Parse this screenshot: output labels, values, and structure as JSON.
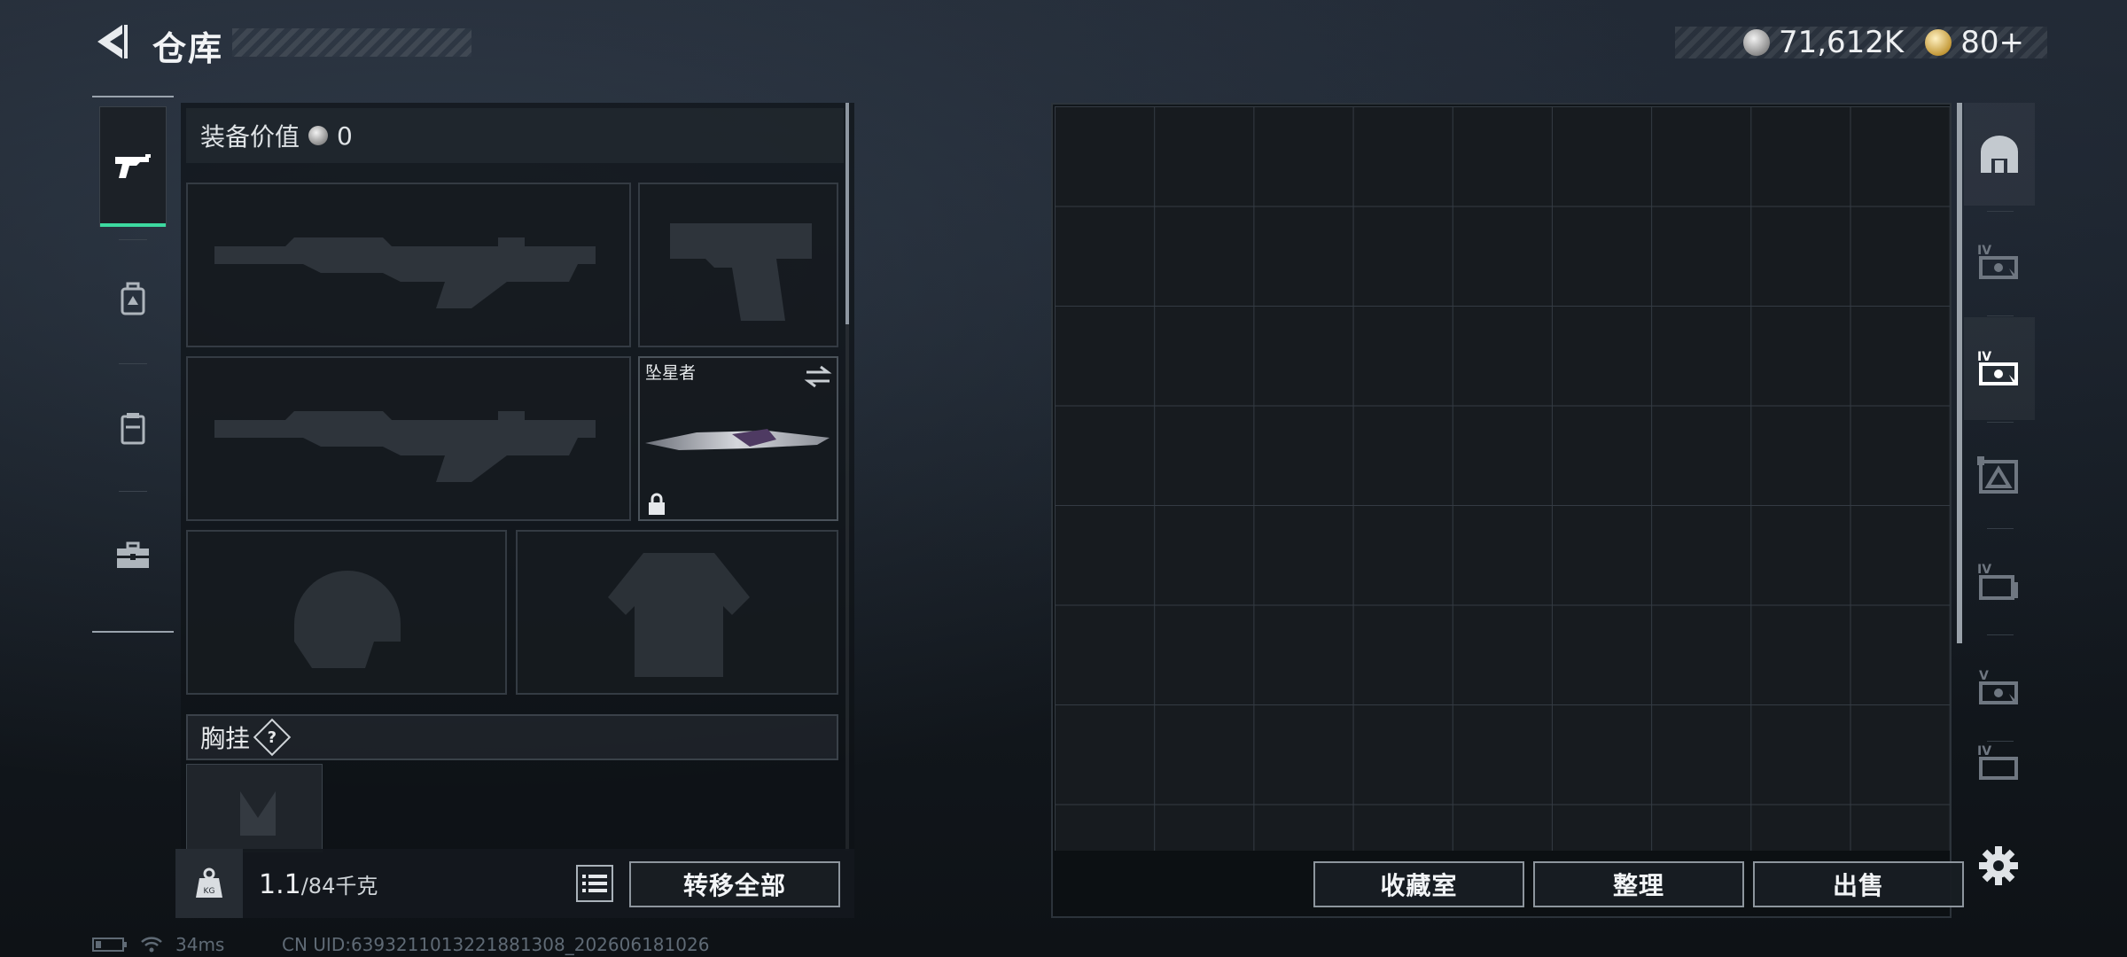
{
  "header": {
    "title": "仓库",
    "currency": [
      {
        "type": "silver",
        "value": "71,612K"
      },
      {
        "type": "gold",
        "value": "80+"
      }
    ]
  },
  "left_tabs": [
    {
      "name": "pistol-icon",
      "active": true
    },
    {
      "name": "backpack-icon",
      "active": false
    },
    {
      "name": "vest-icon",
      "active": false
    },
    {
      "name": "toolbox-icon",
      "active": false
    }
  ],
  "equipment": {
    "value_label": "装备价值",
    "value": "0",
    "melee_name": "坠星者",
    "chest_rig_label": "胸挂",
    "help_symbol": "?"
  },
  "bottom": {
    "weight_current": "1.1",
    "weight_max": "/84千克",
    "transfer_all": "转移全部",
    "collection_room": "收藏室",
    "organize": "整理",
    "sell": "出售"
  },
  "right_tabs": [
    {
      "name": "home-safe-icon",
      "label": ""
    },
    {
      "name": "storage-iv-icon",
      "label": "IV"
    },
    {
      "name": "storage-iv-icon",
      "label": "IV"
    },
    {
      "name": "storage-triangle-icon",
      "label": ""
    },
    {
      "name": "storage-iv-icon",
      "label": "IV"
    },
    {
      "name": "storage-v-icon",
      "label": "V"
    },
    {
      "name": "storage-iv-icon",
      "label": "IV"
    }
  ],
  "status_bar": {
    "ping": "34ms",
    "uid": "CN UID:6393211013221881308_202606181026"
  },
  "colors": {
    "accent": "#3dd9a0",
    "border": "#8d959d"
  }
}
